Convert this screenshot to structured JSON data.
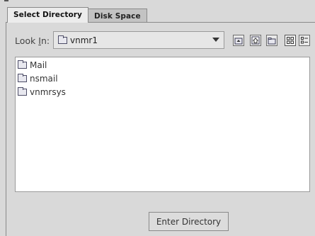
{
  "tabs": [
    {
      "label": "Select Directory",
      "active": true
    },
    {
      "label": "Disk Space",
      "active": false
    }
  ],
  "look_in": {
    "label_prefix": "Look ",
    "label_mnemonic": "I",
    "label_suffix": "n:",
    "current": "vnmr1"
  },
  "toolbar": {
    "up_icon": "up-folder-icon",
    "home_icon": "home-icon",
    "new_folder_icon": "new-folder-icon",
    "list_view_icon": "list-view-icon",
    "details_view_icon": "details-view-icon"
  },
  "files": [
    {
      "name": "Mail",
      "icon": "folder-icon"
    },
    {
      "name": "nsmail",
      "icon": "folder-icon"
    },
    {
      "name": "vnmrsys",
      "icon": "folder-icon"
    }
  ],
  "enter_button": "Enter Directory"
}
